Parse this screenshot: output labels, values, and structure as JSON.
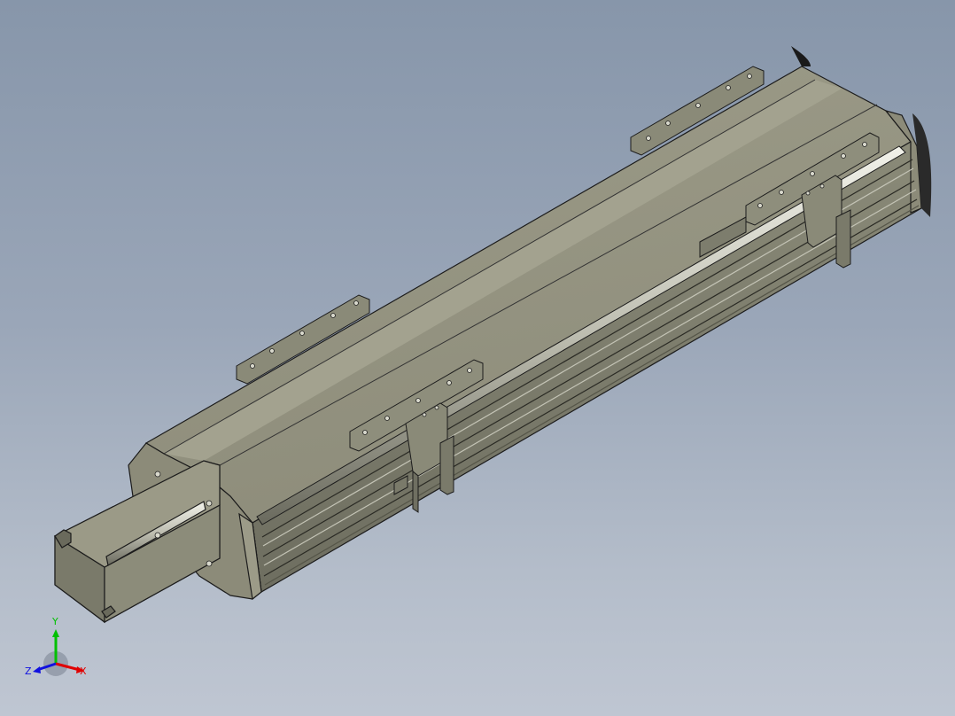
{
  "viewport": {
    "background_top": "#8796aa",
    "background_bottom": "#bfc6d2"
  },
  "model": {
    "body_color": "#8f8f7d",
    "edge_color": "#1c1c1c",
    "highlight_color": "#e6e6dc"
  },
  "triad": {
    "x_label": "X",
    "y_label": "Y",
    "z_label": "Z",
    "x_color": "#e00000",
    "y_color": "#00c000",
    "z_color": "#1010e0"
  }
}
